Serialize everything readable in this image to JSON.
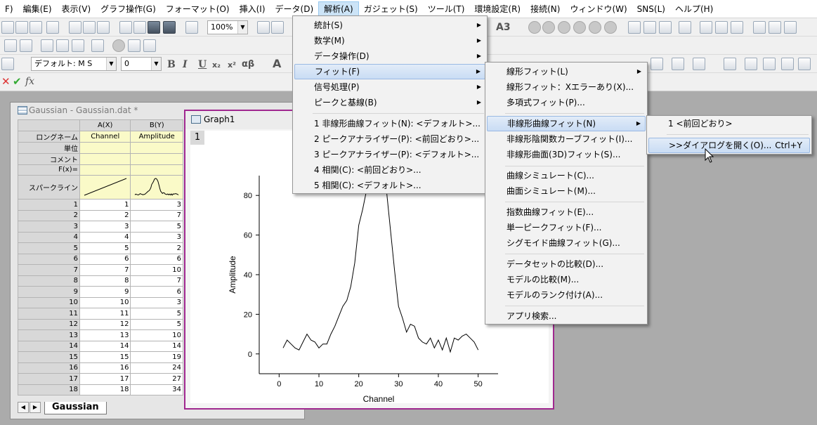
{
  "menubar": [
    "F)",
    "編集(E)",
    "表示(V)",
    "グラフ操作(G)",
    "フォーマット(O)",
    "挿入(I)",
    "データ(D)",
    "解析(A)",
    "ガジェット(S)",
    "ツール(T)",
    "環境設定(R)",
    "接続(N)",
    "ウィンドウ(W)",
    "SNS(L)",
    "ヘルプ(H)"
  ],
  "toolbar": {
    "zoom": "100%",
    "font_name": "デフォルト: M S",
    "font_size": "0",
    "style_buttons": [
      "B",
      "I",
      "U",
      "x₂",
      "x²",
      "αβ",
      "A"
    ],
    "layout_label": "A3"
  },
  "formula_bar": {
    "fx": "fx"
  },
  "workbook": {
    "title": "Gaussian - Gaussian.dat *",
    "columns": [
      "A(X)",
      "B(Y)"
    ],
    "header_rows": [
      {
        "label": "ロングネーム",
        "a": "Channel",
        "b": "Amplitude"
      },
      {
        "label": "単位",
        "a": "",
        "b": ""
      },
      {
        "label": "コメント",
        "a": "",
        "b": ""
      },
      {
        "label": "F(x)=",
        "a": "",
        "b": ""
      },
      {
        "label": "スパークライン",
        "a": "",
        "b": ""
      }
    ],
    "rows": [
      [
        1,
        1,
        3
      ],
      [
        2,
        2,
        7
      ],
      [
        3,
        3,
        5
      ],
      [
        4,
        4,
        3
      ],
      [
        5,
        5,
        2
      ],
      [
        6,
        6,
        6
      ],
      [
        7,
        7,
        10
      ],
      [
        8,
        8,
        7
      ],
      [
        9,
        9,
        6
      ],
      [
        10,
        10,
        3
      ],
      [
        11,
        11,
        5
      ],
      [
        12,
        12,
        5
      ],
      [
        13,
        13,
        10
      ],
      [
        14,
        14,
        14
      ],
      [
        15,
        15,
        19
      ],
      [
        16,
        16,
        24
      ],
      [
        17,
        17,
        27
      ],
      [
        18,
        18,
        34
      ]
    ],
    "sheet_tab": "Gaussian"
  },
  "graph": {
    "title": "Graph1",
    "layer": "1"
  },
  "chart_data": {
    "type": "line",
    "title": "",
    "xlabel": "Channel",
    "ylabel": "Amplitude",
    "xlim": [
      -5,
      55
    ],
    "ylim": [
      -10,
      90
    ],
    "xticks": [
      0,
      10,
      20,
      30,
      40,
      50
    ],
    "yticks": [
      0,
      20,
      40,
      60,
      80
    ],
    "grid": false,
    "x": [
      1,
      2,
      3,
      4,
      5,
      6,
      7,
      8,
      9,
      10,
      11,
      12,
      13,
      14,
      15,
      16,
      17,
      18,
      19,
      20,
      21,
      22,
      23,
      24,
      25,
      26,
      27,
      28,
      29,
      30,
      31,
      32,
      33,
      34,
      35,
      36,
      37,
      38,
      39,
      40,
      41,
      42,
      43,
      44,
      45,
      46,
      47,
      48,
      49,
      50
    ],
    "y": [
      3,
      7,
      5,
      3,
      2,
      6,
      10,
      7,
      6,
      3,
      5,
      5,
      10,
      14,
      19,
      24,
      27,
      34,
      46,
      65,
      73,
      83,
      95,
      100,
      99,
      93,
      82,
      62,
      42,
      24,
      18,
      11,
      15,
      14,
      8,
      6,
      5,
      8,
      3,
      7,
      2,
      8,
      1,
      8,
      7,
      9,
      10,
      8,
      6,
      2
    ]
  },
  "menus": {
    "analysis": [
      "統計(S)",
      "数学(M)",
      "データ操作(D)",
      "フィット(F)",
      "信号処理(P)",
      "ピークと基線(B)",
      "1 非線形曲線フィット(N): <デフォルト>...",
      "2 ピークアナライザー(P): <前回どおり>...",
      "3 ピークアナライザー(P): <デフォルト>...",
      "4 相関(C): <前回どおり>...",
      "5 相関(C): <デフォルト>..."
    ],
    "fit": [
      "線形フィット(L)",
      "線形フィット：Xエラーあり(X)...",
      "多項式フィット(P)...",
      "非線形曲線フィット(N)",
      "非線形陰関数カーブフィット(I)...",
      "非線形曲面(3D)フィット(S)...",
      "曲線シミュレート(C)...",
      "曲面シミュレート(M)...",
      "指数曲線フィット(E)...",
      "単一ピークフィット(F)...",
      "シグモイド曲線フィット(G)...",
      "データセットの比較(D)...",
      "モデルの比較(M)...",
      "モデルのランク付け(A)...",
      "アプリ検索..."
    ],
    "nlfit": [
      "1 <前回どおり>",
      ">>ダイアログを開く(O)..."
    ],
    "nlfit_shortcut": "Ctrl+Y"
  },
  "colors": {
    "graph_border": "#a0288f",
    "menu_highlight": "#c9dcf4",
    "sheet_header": "#fafac8"
  }
}
